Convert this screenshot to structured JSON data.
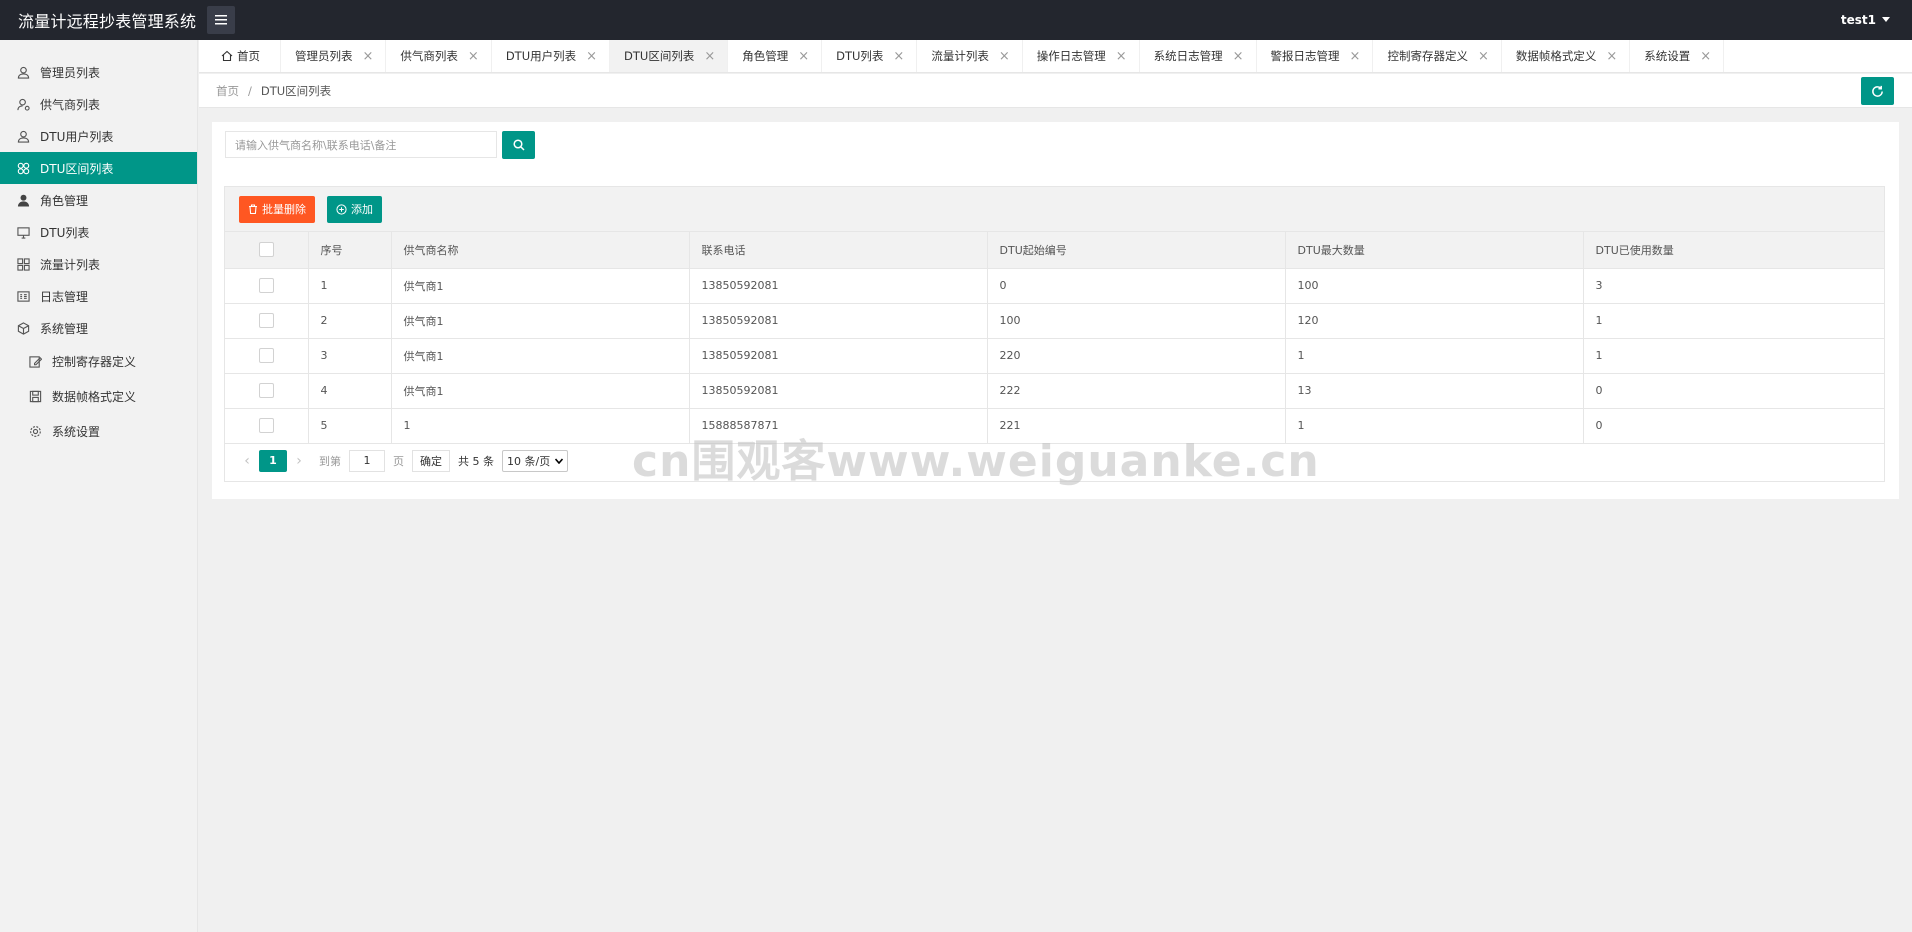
{
  "app": {
    "title": "流量计远程抄表管理系统",
    "user": "test1"
  },
  "colors": {
    "accent": "#009688",
    "danger": "#ff5722",
    "header": "#23262e"
  },
  "sidebar": {
    "items": [
      {
        "label": "管理员列表",
        "icon": "user-outline-icon"
      },
      {
        "label": "供气商列表",
        "icon": "user-settings-icon"
      },
      {
        "label": "DTU用户列表",
        "icon": "user-outline-icon"
      },
      {
        "label": "DTU区间列表",
        "icon": "flower-icon",
        "active": true
      },
      {
        "label": "角色管理",
        "icon": "user-solid-icon"
      },
      {
        "label": "DTU列表",
        "icon": "monitor-icon"
      },
      {
        "label": "流量计列表",
        "icon": "grid-icon"
      },
      {
        "label": "日志管理",
        "icon": "log-icon"
      },
      {
        "label": "系统管理",
        "icon": "cube-icon"
      }
    ],
    "sub_items": [
      {
        "label": "控制寄存器定义",
        "icon": "edit-icon"
      },
      {
        "label": "数据帧格式定义",
        "icon": "save-icon"
      },
      {
        "label": "系统设置",
        "icon": "gear-icon"
      }
    ]
  },
  "tabs": [
    {
      "label": "首页"
    },
    {
      "label": "管理员列表"
    },
    {
      "label": "供气商列表"
    },
    {
      "label": "DTU用户列表"
    },
    {
      "label": "DTU区间列表"
    },
    {
      "label": "角色管理"
    },
    {
      "label": "DTU列表"
    },
    {
      "label": "流量计列表"
    },
    {
      "label": "操作日志管理"
    },
    {
      "label": "系统日志管理"
    },
    {
      "label": "警报日志管理"
    },
    {
      "label": "控制寄存器定义"
    },
    {
      "label": "数据帧格式定义"
    },
    {
      "label": "系统设置"
    }
  ],
  "tab_close": "×",
  "breadcrumb": {
    "home": "首页",
    "sep": "/",
    "current": "DTU区间列表"
  },
  "search": {
    "placeholder": "请输入供气商名称\\联系电话\\备注"
  },
  "toolbar": {
    "batch_delete": "批量删除",
    "add": "添加"
  },
  "table": {
    "headers": [
      "序号",
      "供气商名称",
      "联系电话",
      "DTU起始编号",
      "DTU最大数量",
      "DTU已使用数量"
    ],
    "rows": [
      [
        "1",
        "供气商1",
        "13850592081",
        "0",
        "100",
        "3"
      ],
      [
        "2",
        "供气商1",
        "13850592081",
        "100",
        "120",
        "1"
      ],
      [
        "3",
        "供气商1",
        "13850592081",
        "220",
        "1",
        "1"
      ],
      [
        "4",
        "供气商1",
        "13850592081",
        "222",
        "13",
        "0"
      ],
      [
        "5",
        "1",
        "15888587871",
        "221",
        "1",
        "0"
      ]
    ]
  },
  "pagination": {
    "prev": "‹",
    "next": "›",
    "current_page": "1",
    "goto_label": "到第",
    "goto_value": "1",
    "page_unit": "页",
    "confirm": "确定",
    "total": "共 5 条",
    "page_size": "10 条/页"
  },
  "watermark": "cn围观客www.weiguanke.cn"
}
